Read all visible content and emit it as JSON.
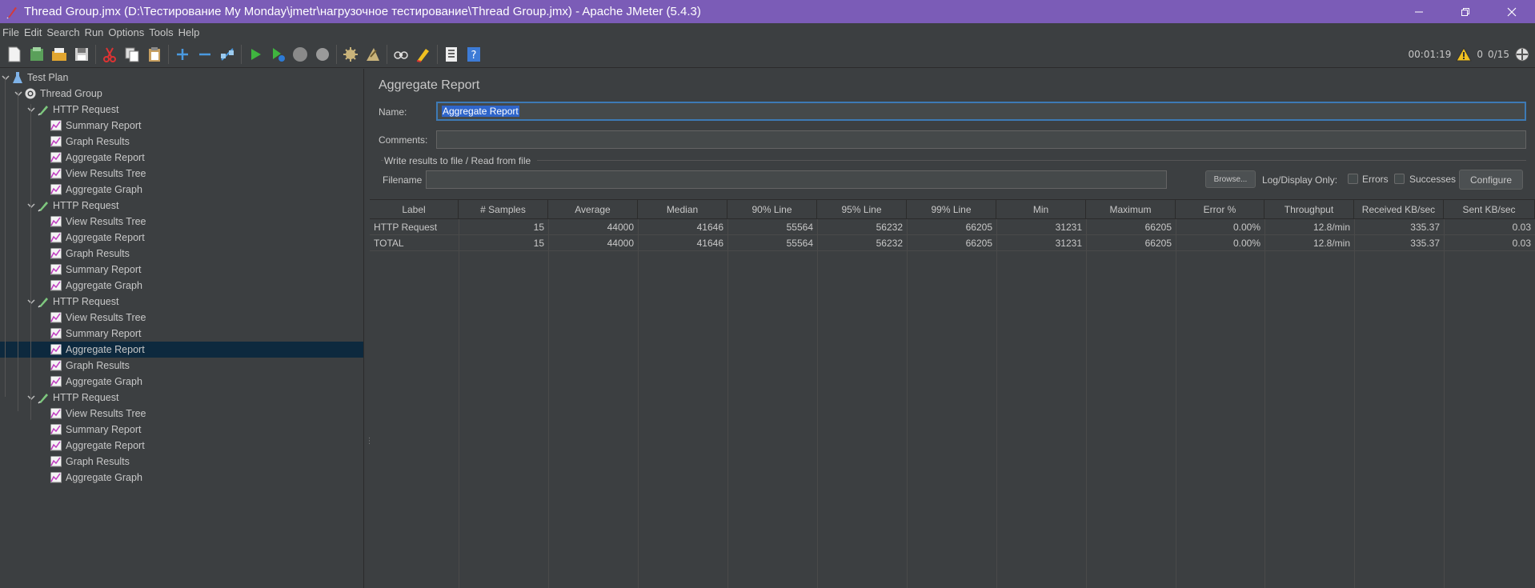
{
  "window": {
    "title": "Thread Group.jmx (D:\\Тестирование My Monday\\jmetr\\нагрузочное тестирование\\Thread Group.jmx) - Apache JMeter (5.4.3)",
    "controls": [
      "minimize",
      "restore",
      "close"
    ]
  },
  "menu": [
    "File",
    "Edit",
    "Search",
    "Run",
    "Options",
    "Tools",
    "Help"
  ],
  "toolbar": {
    "icons": [
      "new-icon",
      "templates-icon",
      "open-icon",
      "save-icon",
      "cut-icon",
      "copy-icon",
      "paste-icon",
      "expand-icon",
      "collapse-icon",
      "toggle-icon",
      "start-icon",
      "start-no-pauses-icon",
      "stop-icon",
      "shutdown-icon",
      "clear-icon",
      "clear-all-icon",
      "search-icon",
      "reset-search-icon",
      "function-helper-icon",
      "help-icon"
    ],
    "elapsed": "00:01:19",
    "warnings": "0",
    "threads": "0/15"
  },
  "tree": [
    {
      "label": "Test Plan",
      "depth": 0,
      "icon": "test-plan-icon",
      "expandable": true
    },
    {
      "label": "Thread Group",
      "depth": 1,
      "icon": "thread-group-icon",
      "expandable": true
    },
    {
      "label": "HTTP Request",
      "depth": 2,
      "icon": "sampler-icon",
      "expandable": true
    },
    {
      "label": "Summary Report",
      "depth": 3,
      "icon": "listener-icon"
    },
    {
      "label": "Graph Results",
      "depth": 3,
      "icon": "listener-icon"
    },
    {
      "label": "Aggregate Report",
      "depth": 3,
      "icon": "listener-icon"
    },
    {
      "label": "View Results Tree",
      "depth": 3,
      "icon": "listener-icon"
    },
    {
      "label": "Aggregate Graph",
      "depth": 3,
      "icon": "listener-icon"
    },
    {
      "label": "HTTP Request",
      "depth": 2,
      "icon": "sampler-icon",
      "expandable": true
    },
    {
      "label": "View Results Tree",
      "depth": 3,
      "icon": "listener-icon"
    },
    {
      "label": "Aggregate Report",
      "depth": 3,
      "icon": "listener-icon"
    },
    {
      "label": "Graph Results",
      "depth": 3,
      "icon": "listener-icon"
    },
    {
      "label": "Summary Report",
      "depth": 3,
      "icon": "listener-icon"
    },
    {
      "label": "Aggregate Graph",
      "depth": 3,
      "icon": "listener-icon"
    },
    {
      "label": "HTTP Request",
      "depth": 2,
      "icon": "sampler-icon",
      "expandable": true
    },
    {
      "label": "View Results Tree",
      "depth": 3,
      "icon": "listener-icon"
    },
    {
      "label": "Summary Report",
      "depth": 3,
      "icon": "listener-icon"
    },
    {
      "label": "Aggregate Report",
      "depth": 3,
      "icon": "listener-icon",
      "selected": true
    },
    {
      "label": "Graph Results",
      "depth": 3,
      "icon": "listener-icon"
    },
    {
      "label": "Aggregate Graph",
      "depth": 3,
      "icon": "listener-icon"
    },
    {
      "label": "HTTP Request",
      "depth": 2,
      "icon": "sampler-icon",
      "expandable": true
    },
    {
      "label": "View Results Tree",
      "depth": 3,
      "icon": "listener-icon"
    },
    {
      "label": "Summary Report",
      "depth": 3,
      "icon": "listener-icon"
    },
    {
      "label": "Aggregate Report",
      "depth": 3,
      "icon": "listener-icon"
    },
    {
      "label": "Graph Results",
      "depth": 3,
      "icon": "listener-icon"
    },
    {
      "label": "Aggregate Graph",
      "depth": 3,
      "icon": "listener-icon"
    }
  ],
  "panel": {
    "title": "Aggregate Report",
    "name_label": "Name:",
    "name_value": "Aggregate Report",
    "comments_label": "Comments:",
    "comments_value": "",
    "file_group_label": "Write results to file / Read from file",
    "filename_label": "Filename",
    "filename_value": "",
    "browse_label": "Browse...",
    "log_display_label": "Log/Display Only:",
    "errors_label": "Errors",
    "successes_label": "Successes",
    "configure_label": "Configure"
  },
  "table": {
    "columns": [
      "Label",
      "# Samples",
      "Average",
      "Median",
      "90% Line",
      "95% Line",
      "99% Line",
      "Min",
      "Maximum",
      "Error %",
      "Throughput",
      "Received KB/sec",
      "Sent KB/sec"
    ],
    "rows": [
      [
        "HTTP Request",
        "15",
        "44000",
        "41646",
        "55564",
        "56232",
        "66205",
        "31231",
        "66205",
        "0.00%",
        "12.8/min",
        "335.37",
        "0.03"
      ],
      [
        "TOTAL",
        "15",
        "44000",
        "41646",
        "55564",
        "56232",
        "66205",
        "31231",
        "66205",
        "0.00%",
        "12.8/min",
        "335.37",
        "0.03"
      ]
    ]
  }
}
